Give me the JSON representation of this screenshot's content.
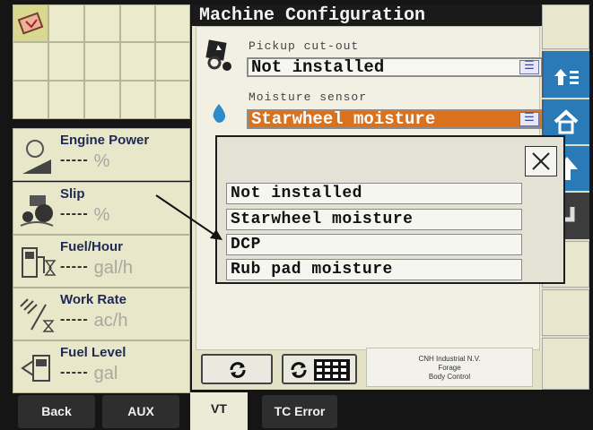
{
  "title": "Machine Configuration",
  "gauges": [
    {
      "label": "Engine Power",
      "value": "-----",
      "unit": "%",
      "icon": "engine-icon"
    },
    {
      "label": "Slip",
      "value": "-----",
      "unit": "%",
      "icon": "tractor-slip-icon"
    },
    {
      "label": "Fuel/Hour",
      "value": "-----",
      "unit": "gal/h",
      "icon": "fuel-pump-icon"
    },
    {
      "label": "Work Rate",
      "value": "-----",
      "unit": "ac/h",
      "icon": "work-rate-icon"
    },
    {
      "label": "Fuel Level",
      "value": "-----",
      "unit": "gal",
      "icon": "fuel-level-icon"
    }
  ],
  "fields": {
    "pickup": {
      "label": "Pickup cut-out",
      "value": "Not installed"
    },
    "moisture": {
      "label": "Moisture sensor",
      "value": "Starwheel moisture"
    }
  },
  "dialog": {
    "options": [
      "Not installed",
      "Starwheel moisture",
      "DCP",
      "Rub pad moisture"
    ]
  },
  "cnh": {
    "line1": "CNH Industrial N.V.",
    "line2": "Forage",
    "line3": "Body Control"
  },
  "tabs": {
    "back": "Back",
    "aux": "AUX",
    "vt": "VT",
    "tc_error": "TC Error"
  },
  "colors": {
    "accent_orange": "#d9711d",
    "side_blue": "#2a7ab8",
    "title_bar": "#1a1a1a"
  }
}
